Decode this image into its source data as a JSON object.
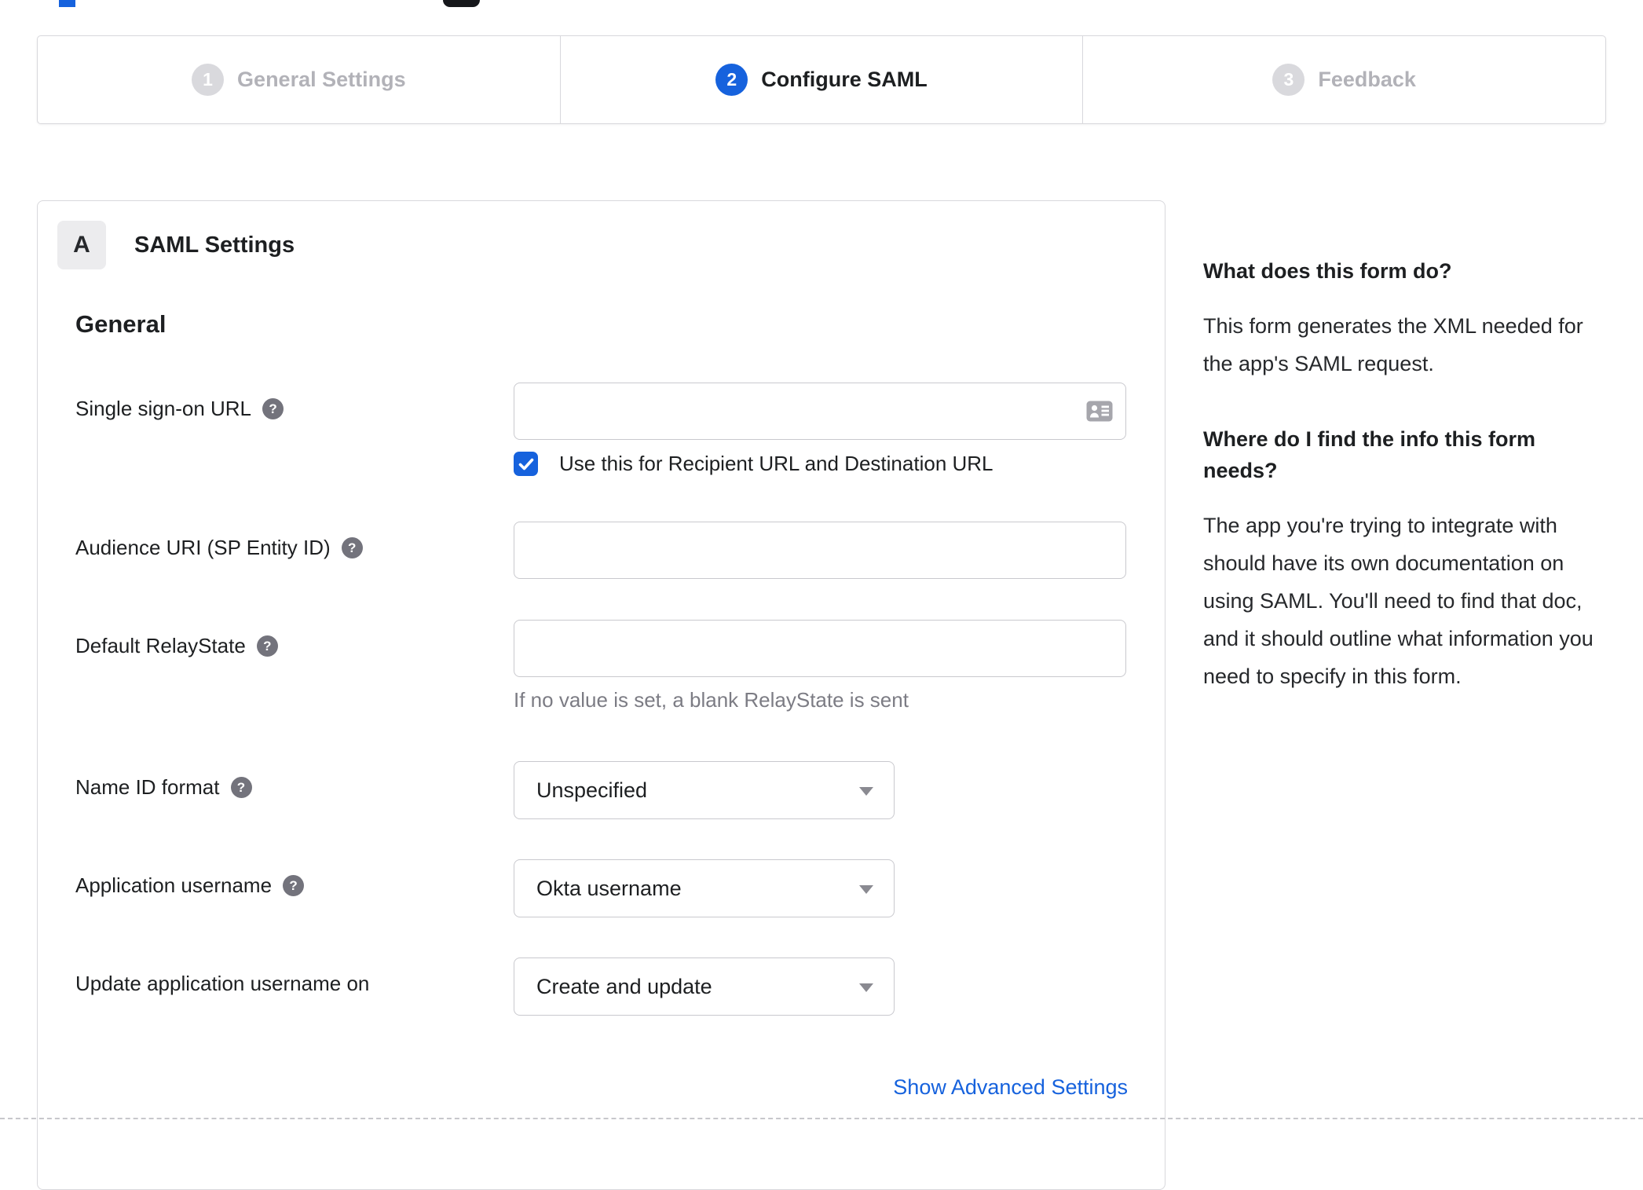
{
  "colors": {
    "accent": "#1662dd",
    "inactive_step_circle": "#d9d9dd",
    "border": "#d8d8dc",
    "helper_text": "#7c7c84"
  },
  "stepper": {
    "steps": [
      {
        "number": "1",
        "label": "General Settings",
        "state": "inactive"
      },
      {
        "number": "2",
        "label": "Configure SAML",
        "state": "active"
      },
      {
        "number": "3",
        "label": "Feedback",
        "state": "inactive"
      }
    ]
  },
  "panel": {
    "section_badge": "A",
    "section_title": "SAML Settings",
    "group_heading": "General",
    "fields": {
      "sso_url": {
        "label": "Single sign-on URL",
        "value": "",
        "icon": "contact-card-icon",
        "checkbox_label": "Use this for Recipient URL and Destination URL",
        "checkbox_checked": true
      },
      "audience_uri": {
        "label": "Audience URI (SP Entity ID)",
        "value": ""
      },
      "relay_state": {
        "label": "Default RelayState",
        "value": "",
        "helper": "If no value is set, a blank RelayState is sent"
      },
      "name_id": {
        "label": "Name ID format",
        "value": "Unspecified"
      },
      "app_username": {
        "label": "Application username",
        "value": "Okta username"
      },
      "update_username": {
        "label": "Update application username on",
        "value": "Create and update"
      }
    },
    "advanced_link": "Show Advanced Settings"
  },
  "sidebar": {
    "sections": [
      {
        "heading": "What does this form do?",
        "body": "This form generates the XML needed for the app's SAML request."
      },
      {
        "heading": "Where do I find the info this form needs?",
        "body": "The app you're trying to integrate with should have its own documentation on using SAML. You'll need to find that doc, and it should outline what information you need to specify in this form."
      }
    ]
  }
}
